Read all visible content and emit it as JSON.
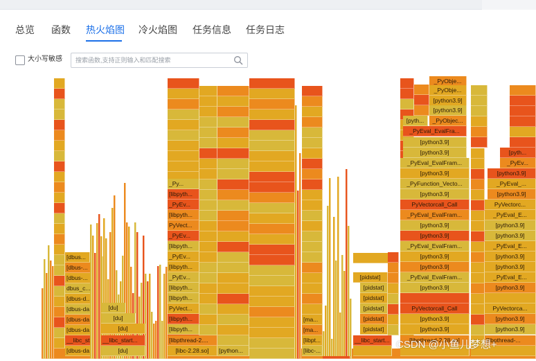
{
  "tabs": [
    {
      "label": "总览",
      "active": false
    },
    {
      "label": "函数",
      "active": false
    },
    {
      "label": "热火焰图",
      "active": true
    },
    {
      "label": "冷火焰图",
      "active": false
    },
    {
      "label": "任务信息",
      "active": false
    },
    {
      "label": "任务日志",
      "active": false
    }
  ],
  "filter": {
    "case_sensitive_label": "大小写敏感",
    "case_sensitive_checked": false,
    "search_placeholder": "搜索函数,支持正则输入和匹配搜索",
    "search_value": ""
  },
  "colors": {
    "accent": "#1a6fe8",
    "flame_red": "#e8541c",
    "flame_orange": "#ec8a1e",
    "flame_amber": "#e2a822",
    "flame_yellow": "#d8b83a"
  },
  "flamegraph": {
    "labels": {
      "dbus_1": "[dbus...",
      "dbus_2": "[dbus-...",
      "dbus_3": "[dbus-...",
      "dbus_c": "dbus_c...",
      "dbus_d1": "[dbus-d...",
      "dbus_da1": "[dbus-da...",
      "dbus_da2": "[dbus-da...",
      "dbus_da3": "[dbus-da...",
      "dbus_da4": "[dbus-da...",
      "libc_st": "__libc_st...",
      "du_1": "[du]",
      "du_2": "[du]",
      "du_3": "[du]",
      "du_4": "[du]",
      "libc_start": "__libc_start...",
      "py_a1": "_Py...",
      "libpy_a": "[libpyth...",
      "pyev_a1": "_PyEv...",
      "libpy_b": "[libpyth...",
      "pyvect_a": "PyVect...",
      "pyev_a2": "_PyEv...",
      "libpy_c": "[libpyth...",
      "pyev_a3": "_PyEv...",
      "libpy_d": "[libpyth...",
      "pyev_a4": "_PyEv...",
      "libpy_e": "[libpyth...",
      "libpy_f": "[libpyth...",
      "pyvect_b": "PyVect...",
      "libpy_g": "[libpyth...",
      "libpy_h": "[libpyth...",
      "libpthread": "[libpthread-2....",
      "libc228": "[libc-2.28.so]",
      "python_a": "[python...",
      "ma_1": "[ma...",
      "ma_2": "[ma...",
      "libpt": "[libpt...",
      "libc_short": "[libc-...",
      "pidstat_1": "[pidstat]",
      "pidstat_2": "[pidstat]",
      "pidstat_3": "[pidstat]",
      "pidstat_4": "[pidstat]",
      "pidstat_5": "[pidstat]",
      "pidstat_6": "[pidstat]",
      "libc_start2": "__libc_start...",
      "pyobje_1": "_PyObje...",
      "pyobje_2": "_PyObje...",
      "py39_c1": "[python3.9]",
      "py39_c2": "[python3.9]",
      "pyth_c": "[pyth...",
      "pyobjec_c": "_PyObjec...",
      "pyeval_fra": "_PyEval_EvalFra...",
      "py39_c3": "[python3.9]",
      "py39_c4": "[python3.9]",
      "pyeval_fram_1": "_PyEval_EvalFram...",
      "py39_c5": "[python3.9]",
      "pyfunc_vecto": "_PyFunction_Vecto...",
      "py39_c6": "[python3.9]",
      "pyvectorcall_1": "PyVectorcall_Call",
      "pyeval_fram_2": "_PyEval_EvalFram...",
      "py39_c7": "[python3.9]",
      "py39_c8": "[python3.9]",
      "pyeval_fram_3": "_PyEval_EvalFram...",
      "py39_c9": "[python3.9]",
      "py39_c10": "[python3.9]",
      "pyeval_fram_4": "_PyEval_EvalFram...",
      "py39_c11": "[python3.9]",
      "pyvectorcall_2": "PyVectorcall_Call",
      "py39_c12": "[python3.9]",
      "py39_c13": "[python3.9]",
      "libpthread_2": "[libpthread-2.28.so]",
      "pyth_r": "[pyth...",
      "pyev_r1": "_PyEv...",
      "py39_r1": "[python3.9]",
      "pyeval_r1": "_PyEval_...",
      "py39_r2": "[python3.9]",
      "pyvectorc_r": "PyVectorc...",
      "pyeval_e_r1": "_PyEval_E...",
      "py39_r3": "[python3.9]",
      "py39_r4": "[python3.9]",
      "pyeval_e_r2": "_PyEval_E...",
      "py39_r5": "[python3.9]",
      "py39_r6": "[python3.9]",
      "pyeval_e_r3": "_PyEval_E...",
      "py39_r7": "[python3.9]",
      "pyvectorca_r": "PyVectorca...",
      "py39_r8": "[python3.9]",
      "py39_r9": "[python3.9]",
      "lipthread_r": "[libpthread-..."
    }
  },
  "watermark": "CSDN @小鱼儿梦想+"
}
